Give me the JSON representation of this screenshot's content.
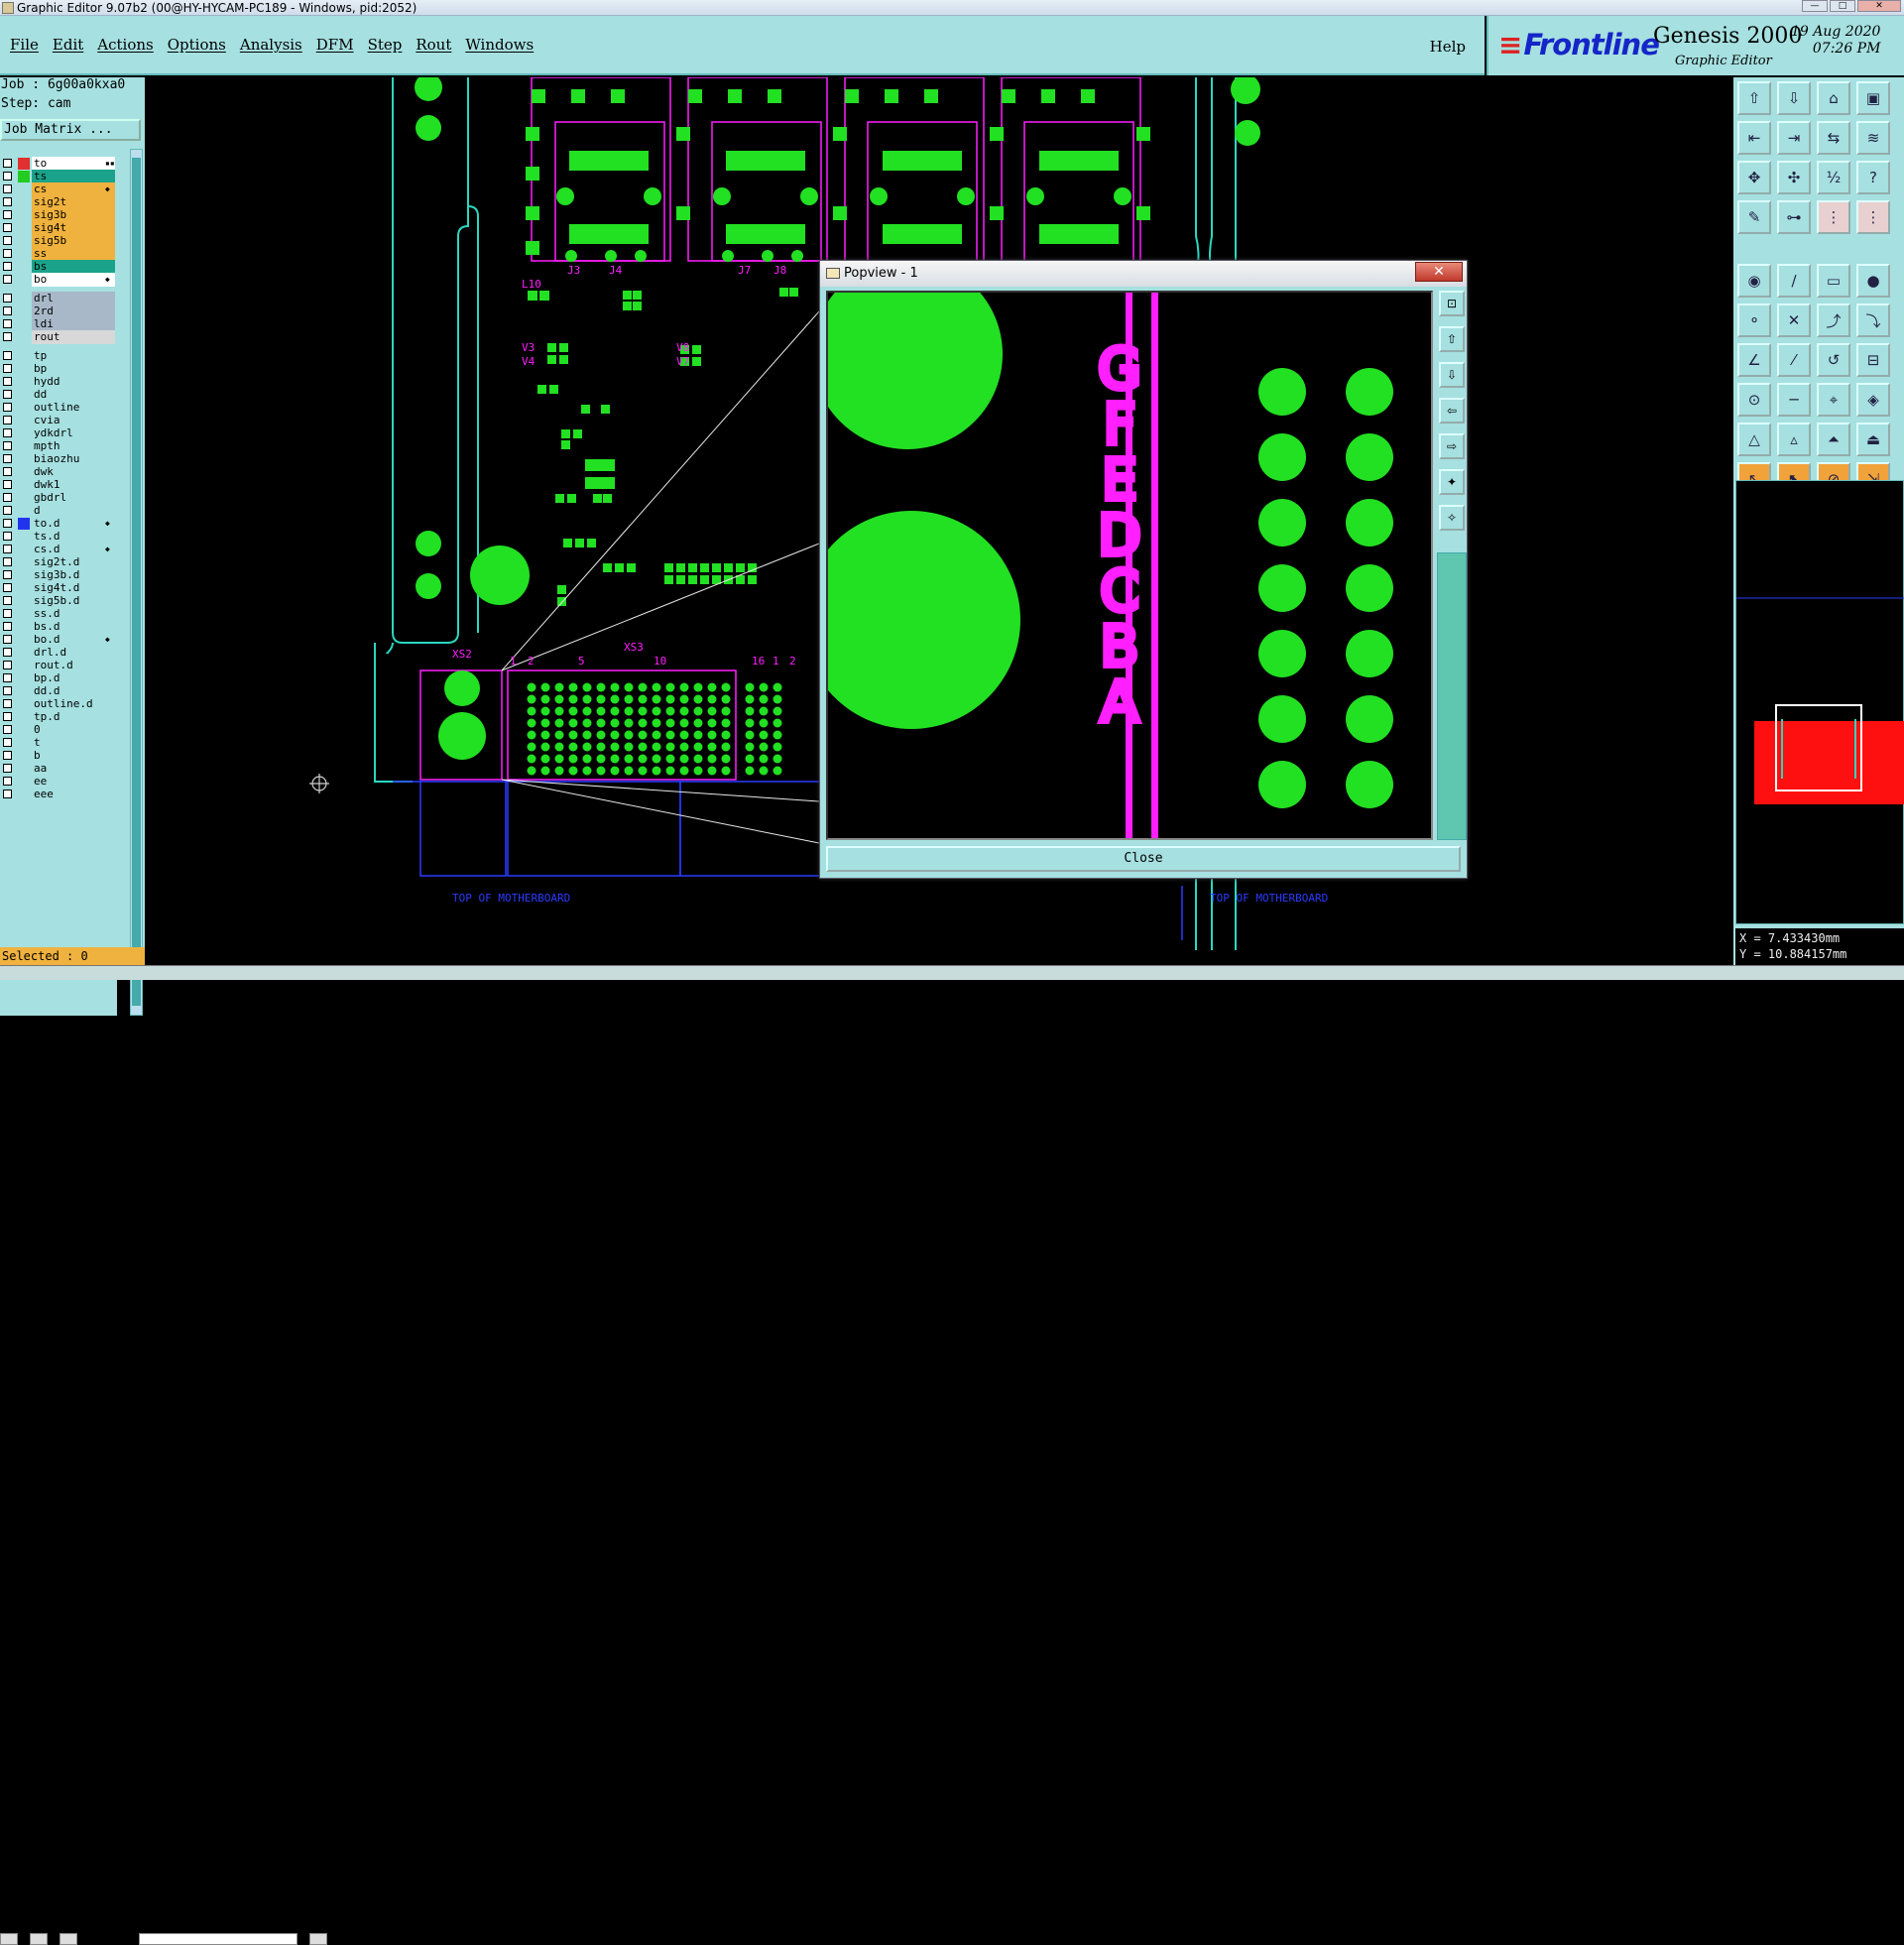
{
  "window": {
    "title": "Graphic Editor 9.07b2 (00@HY-HYCAM-PC189 - Windows, pid:2052)"
  },
  "menu": {
    "items": [
      "File",
      "Edit",
      "Actions",
      "Options",
      "Analysis",
      "DFM",
      "Step",
      "Rout",
      "Windows"
    ],
    "help": "Help"
  },
  "brand": {
    "logo": "Frontline",
    "product": "Genesis 2000",
    "subtitle": "Graphic Editor",
    "date": "19 Aug 2020",
    "time": "07:26 PM"
  },
  "job": {
    "job_line": "Job : 6g00a0kxa0",
    "step_line": "Step: cam",
    "matrix_button": "Job Matrix ..."
  },
  "layers": [
    {
      "name": "to",
      "color": "#ffffff",
      "swatch": "#e03030",
      "mark": "▪▪"
    },
    {
      "name": "ts",
      "color": "#1aa38a",
      "swatch": "#22cc22",
      "mark": ""
    },
    {
      "name": "cs",
      "color": "#f0b23e",
      "swatch": "",
      "mark": "◆"
    },
    {
      "name": "sig2t",
      "color": "#f0b23e",
      "swatch": "",
      "mark": ""
    },
    {
      "name": "sig3b",
      "color": "#f0b23e",
      "swatch": "",
      "mark": ""
    },
    {
      "name": "sig4t",
      "color": "#f0b23e",
      "swatch": "",
      "mark": ""
    },
    {
      "name": "sig5b",
      "color": "#f0b23e",
      "swatch": "",
      "mark": ""
    },
    {
      "name": "ss",
      "color": "#f0b23e",
      "swatch": "",
      "mark": ""
    },
    {
      "name": "bs",
      "color": "#1aa38a",
      "swatch": "",
      "mark": ""
    },
    {
      "name": "bo",
      "color": "#ffffff",
      "swatch": "",
      "mark": "◆"
    },
    {
      "name": "drl",
      "color": "#a8b8c8",
      "swatch": "",
      "mark": ""
    },
    {
      "name": "2rd",
      "color": "#a8b8c8",
      "swatch": "",
      "mark": ""
    },
    {
      "name": "ldi",
      "color": "#a8b8c8",
      "swatch": "",
      "mark": ""
    },
    {
      "name": "rout",
      "color": "#d8d8d8",
      "swatch": "",
      "mark": ""
    },
    {
      "name": "tp",
      "color": "#a6e0e0",
      "swatch": "",
      "mark": ""
    },
    {
      "name": "bp",
      "color": "#a6e0e0",
      "swatch": "",
      "mark": ""
    },
    {
      "name": "hydd",
      "color": "#a6e0e0",
      "swatch": "",
      "mark": ""
    },
    {
      "name": "dd",
      "color": "#a6e0e0",
      "swatch": "",
      "mark": ""
    },
    {
      "name": "outline",
      "color": "#a6e0e0",
      "swatch": "",
      "mark": ""
    },
    {
      "name": "cvia",
      "color": "#a6e0e0",
      "swatch": "",
      "mark": ""
    },
    {
      "name": "ydkdrl",
      "color": "#a6e0e0",
      "swatch": "",
      "mark": ""
    },
    {
      "name": "mpth",
      "color": "#a6e0e0",
      "swatch": "",
      "mark": ""
    },
    {
      "name": "biaozhu",
      "color": "#a6e0e0",
      "swatch": "",
      "mark": ""
    },
    {
      "name": "dwk",
      "color": "#a6e0e0",
      "swatch": "",
      "mark": ""
    },
    {
      "name": "dwk1",
      "color": "#a6e0e0",
      "swatch": "",
      "mark": ""
    },
    {
      "name": "gbdrl",
      "color": "#a6e0e0",
      "swatch": "",
      "mark": ""
    },
    {
      "name": "d",
      "color": "#a6e0e0",
      "swatch": "",
      "mark": ""
    },
    {
      "name": "to.d",
      "color": "#a6e0e0",
      "swatch": "#2233ee",
      "mark": "◆"
    },
    {
      "name": "ts.d",
      "color": "#a6e0e0",
      "swatch": "",
      "mark": ""
    },
    {
      "name": "cs.d",
      "color": "#a6e0e0",
      "swatch": "",
      "mark": "◆"
    },
    {
      "name": "sig2t.d",
      "color": "#a6e0e0",
      "swatch": "",
      "mark": ""
    },
    {
      "name": "sig3b.d",
      "color": "#a6e0e0",
      "swatch": "",
      "mark": ""
    },
    {
      "name": "sig4t.d",
      "color": "#a6e0e0",
      "swatch": "",
      "mark": ""
    },
    {
      "name": "sig5b.d",
      "color": "#a6e0e0",
      "swatch": "",
      "mark": ""
    },
    {
      "name": "ss.d",
      "color": "#a6e0e0",
      "swatch": "",
      "mark": ""
    },
    {
      "name": "bs.d",
      "color": "#a6e0e0",
      "swatch": "",
      "mark": ""
    },
    {
      "name": "bo.d",
      "color": "#a6e0e0",
      "swatch": "",
      "mark": "◆"
    },
    {
      "name": "drl.d",
      "color": "#a6e0e0",
      "swatch": "",
      "mark": ""
    },
    {
      "name": "rout.d",
      "color": "#a6e0e0",
      "swatch": "",
      "mark": ""
    },
    {
      "name": "bp.d",
      "color": "#a6e0e0",
      "swatch": "",
      "mark": ""
    },
    {
      "name": "dd.d",
      "color": "#a6e0e0",
      "swatch": "",
      "mark": ""
    },
    {
      "name": "outline.d",
      "color": "#a6e0e0",
      "swatch": "",
      "mark": ""
    },
    {
      "name": "tp.d",
      "color": "#a6e0e0",
      "swatch": "",
      "mark": ""
    },
    {
      "name": "0",
      "color": "#a6e0e0",
      "swatch": "",
      "mark": ""
    },
    {
      "name": "t",
      "color": "#a6e0e0",
      "swatch": "",
      "mark": ""
    },
    {
      "name": "b",
      "color": "#a6e0e0",
      "swatch": "",
      "mark": ""
    },
    {
      "name": "aa",
      "color": "#a6e0e0",
      "swatch": "",
      "mark": ""
    },
    {
      "name": "ee",
      "color": "#a6e0e0",
      "swatch": "",
      "mark": ""
    },
    {
      "name": "eee",
      "color": "#a6e0e0",
      "swatch": "",
      "mark": ""
    }
  ],
  "selected": "Selected : 0",
  "canvas_labels": {
    "j3": "J3",
    "j4": "J4",
    "j7": "J7",
    "j8": "J8",
    "l10": "L10",
    "v3": "V3",
    "v4": "V4",
    "v8": "V8",
    "v7": "V7",
    "xs2": "XS2",
    "xs3": "XS3",
    "n1": "1",
    "n2": "2",
    "n5": "5",
    "n10": "10",
    "n16": "16",
    "n1b": "1",
    "n2b": "2",
    "motherboard1": "TOP OF MOTHERBOARD",
    "motherboard2": "TOP OF MOTHERBOARD"
  },
  "popview": {
    "title": "Popview - 1",
    "close_x": "✕",
    "close_button": "Close",
    "letters": [
      "G",
      "F",
      "E",
      "D",
      "C",
      "B",
      "A"
    ]
  },
  "coords": {
    "x": "X = 7.433430mm",
    "y": "Y = 10.884157mm"
  },
  "colors": {
    "panel": "#a6e0e0",
    "copper": "#22e022",
    "silk": "#ff1fff",
    "profile": "#2a3bff",
    "outline": "#2bd6c0"
  }
}
